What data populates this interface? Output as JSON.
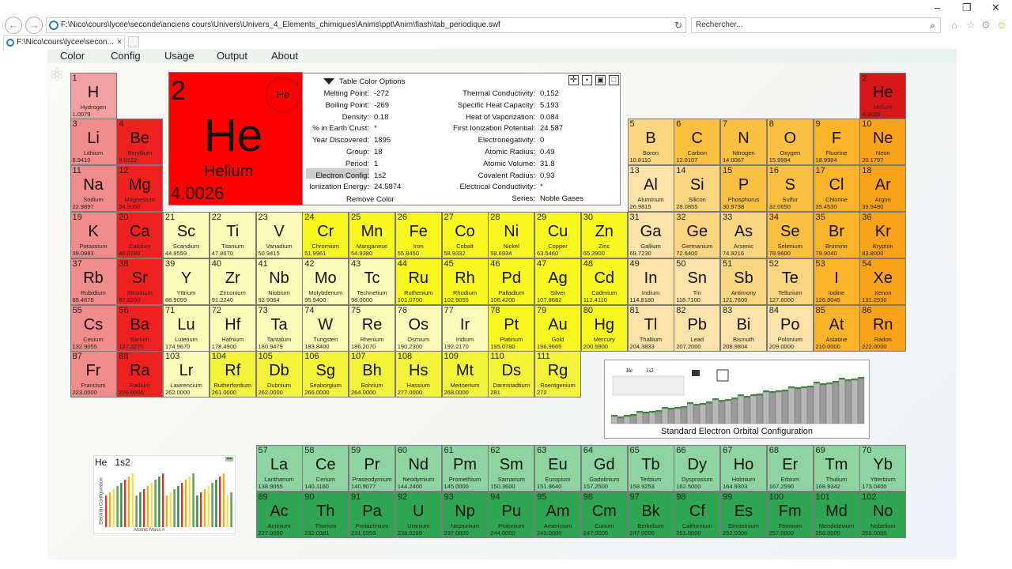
{
  "browser": {
    "address": "F:\\Nico\\cours\\lycee\\seconde\\anciens cours\\Univers\\Univers_4_Elements_chimiques\\Anims\\ppt\\Anim\\flash\\tab_periodique.swf",
    "search_placeholder": "Rechercher...",
    "tab_title": "F:\\Nico\\cours\\lycee\\secon...",
    "back_icon": "←",
    "forward_icon": "→",
    "refresh_icon": "↻",
    "tab_close": "×",
    "search_icon": "⌕",
    "minimize": "–",
    "restore": "❐",
    "close": "✕",
    "home_icon": "⌂",
    "star_icon": "☆",
    "gear_icon": "⚙",
    "smiley_icon": "☺"
  },
  "menu": [
    "Color",
    "Config",
    "Usage",
    "Output",
    "About"
  ],
  "selected": {
    "number": "2",
    "symbol": "He",
    "name": "Helium",
    "mass": "4.0026",
    "orbital_symbol": "He",
    "table_color_options": "Table Color Options",
    "remove_color": "Remove Color",
    "left_props": [
      [
        "Melting Point:",
        "-272"
      ],
      [
        "Boiling Point:",
        "-269"
      ],
      [
        "Density:",
        "0.18"
      ],
      [
        "% in Earth Crust:",
        "*"
      ],
      [
        "Year Discovered:",
        "1895"
      ],
      [
        "Group:",
        "18"
      ],
      [
        "Period:",
        "1"
      ],
      [
        "Electron Config:",
        "1s2"
      ],
      [
        "Ionization Energy:",
        "24.5874"
      ]
    ],
    "right_props": [
      [
        "Thermal Conductivity:",
        "0.152"
      ],
      [
        "Specific Heat Capacity:",
        "5.193"
      ],
      [
        "Heat of Vaporization:",
        "0.084"
      ],
      [
        "First Ionization Potential:",
        "24.587"
      ],
      [
        "Electronegativity:",
        "0"
      ],
      [
        "Atomic Radius:",
        "0.49"
      ],
      [
        "Atomic Volume:",
        "31.8"
      ],
      [
        "Covalent Radius:",
        "0.93"
      ],
      [
        "Electrical Conductivity:",
        "*"
      ],
      [
        "Series:",
        "Noble Gases"
      ]
    ]
  },
  "orbital_panel": {
    "caption": "Standard Electron Orbital Configuration",
    "title_symbol": "He",
    "title_config": "1s2"
  },
  "mini_chart": {
    "title_symbol": "He",
    "title_config": "1s2",
    "xlabel": "Atomic Mass #",
    "ylabel": "Electron Configuration"
  },
  "colors": {
    "alkali": "#f08c8c",
    "alkaline": "#ee2020",
    "transition": "#fdfbb8",
    "transition_bright": "#f8f820",
    "post": "#fbe2a8",
    "metalloid": "#fbd580",
    "nonmetal": "#fbc040",
    "halogen": "#fbb428",
    "noble": "#fba318",
    "helium": "#d81818",
    "hydrogen": "#f5a0a0",
    "superheavy": "#f3f33a",
    "lanthanide": "#8ed4a0",
    "actinide": "#2ea552"
  },
  "elements": [
    [
      "1",
      "H",
      "Hydrogen",
      "1.0079"
    ],
    [
      "2",
      "He",
      "Helium",
      "4.0026"
    ],
    [
      "3",
      "Li",
      "Lithium",
      "6.9410"
    ],
    [
      "4",
      "Be",
      "Beryllium",
      "9.0122"
    ],
    [
      "5",
      "B",
      "Boron",
      "10.8110"
    ],
    [
      "6",
      "C",
      "Carbon",
      "12.0107"
    ],
    [
      "7",
      "N",
      "Nitrogen",
      "14.0067"
    ],
    [
      "8",
      "O",
      "Oxygen",
      "15.9994"
    ],
    [
      "9",
      "F",
      "Fluorine",
      "18.9984"
    ],
    [
      "10",
      "Ne",
      "Neon",
      "20.1797"
    ],
    [
      "11",
      "Na",
      "Sodium",
      "22.9897"
    ],
    [
      "12",
      "Mg",
      "Magnesium",
      "24.3050"
    ],
    [
      "13",
      "Al",
      "Aluminum",
      "26.9815"
    ],
    [
      "14",
      "Si",
      "Silicon",
      "28.0855"
    ],
    [
      "15",
      "P",
      "Phosphorus",
      "30.9738"
    ],
    [
      "16",
      "S",
      "Sulfur",
      "32.0650"
    ],
    [
      "17",
      "Cl",
      "Chlorine",
      "35.4530"
    ],
    [
      "18",
      "Ar",
      "Argon",
      "39.9480"
    ],
    [
      "19",
      "K",
      "Potassium",
      "39.0983"
    ],
    [
      "20",
      "Ca",
      "Calcium",
      "40.0780"
    ],
    [
      "21",
      "Sc",
      "Scandium",
      "44.9559"
    ],
    [
      "22",
      "Ti",
      "Titanium",
      "47.8670"
    ],
    [
      "23",
      "V",
      "Vanadium",
      "50.9415"
    ],
    [
      "24",
      "Cr",
      "Chromium",
      "51.9961"
    ],
    [
      "25",
      "Mn",
      "Manganese",
      "54.9380"
    ],
    [
      "26",
      "Fe",
      "Iron",
      "55.8450"
    ],
    [
      "27",
      "Co",
      "Cobalt",
      "58.9332"
    ],
    [
      "28",
      "Ni",
      "Nickel",
      "58.6934"
    ],
    [
      "29",
      "Cu",
      "Copper",
      "63.5460"
    ],
    [
      "30",
      "Zn",
      "Zinc",
      "65.3900"
    ],
    [
      "31",
      "Ga",
      "Gallium",
      "69.7230"
    ],
    [
      "32",
      "Ge",
      "Germanium",
      "72.6400"
    ],
    [
      "33",
      "As",
      "Arsenic",
      "74.9216"
    ],
    [
      "34",
      "Se",
      "Selenium",
      "78.9600"
    ],
    [
      "35",
      "Br",
      "Bromine",
      "79.9040"
    ],
    [
      "36",
      "Kr",
      "Krypton",
      "83.8000"
    ],
    [
      "37",
      "Rb",
      "Rubidium",
      "85.4678"
    ],
    [
      "38",
      "Sr",
      "Strontium",
      "87.6200"
    ],
    [
      "39",
      "Y",
      "Yttrium",
      "88.9059"
    ],
    [
      "40",
      "Zr",
      "Zirconium",
      "91.2240"
    ],
    [
      "41",
      "Nb",
      "Niobium",
      "92.9064"
    ],
    [
      "42",
      "Mo",
      "Molybdenum",
      "95.9400"
    ],
    [
      "43",
      "Tc",
      "Technetium",
      "98.0000"
    ],
    [
      "44",
      "Ru",
      "Ruthenium",
      "101.0700"
    ],
    [
      "45",
      "Rh",
      "Rhodium",
      "102.9055"
    ],
    [
      "46",
      "Pd",
      "Palladium",
      "106.4200"
    ],
    [
      "47",
      "Ag",
      "Silver",
      "107.8682"
    ],
    [
      "48",
      "Cd",
      "Cadmium",
      "112.4110"
    ],
    [
      "49",
      "In",
      "Indium",
      "114.8180"
    ],
    [
      "50",
      "Sn",
      "Tin",
      "118.7100"
    ],
    [
      "51",
      "Sb",
      "Antimony",
      "121.7600"
    ],
    [
      "52",
      "Te",
      "Tellurium",
      "127.6000"
    ],
    [
      "53",
      "I",
      "Iodine",
      "126.9045"
    ],
    [
      "54",
      "Xe",
      "Xenon",
      "131.2930"
    ],
    [
      "55",
      "Cs",
      "Cesium",
      "132.9055"
    ],
    [
      "56",
      "Ba",
      "Barium",
      "137.3270"
    ],
    [
      "71",
      "Lu",
      "Lutetium",
      "174.9670"
    ],
    [
      "72",
      "Hf",
      "Hafnium",
      "178.4900"
    ],
    [
      "73",
      "Ta",
      "Tantalum",
      "180.9479"
    ],
    [
      "74",
      "W",
      "Tungsten",
      "183.8400"
    ],
    [
      "75",
      "Re",
      "Rhenium",
      "186.2070"
    ],
    [
      "76",
      "Os",
      "Osmium",
      "190.2300"
    ],
    [
      "77",
      "Ir",
      "Iridium",
      "192.2170"
    ],
    [
      "78",
      "Pt",
      "Platinum",
      "195.0780"
    ],
    [
      "79",
      "Au",
      "Gold",
      "196.9665"
    ],
    [
      "80",
      "Hg",
      "Mercury",
      "200.5900"
    ],
    [
      "81",
      "Tl",
      "Thallium",
      "204.3833"
    ],
    [
      "82",
      "Pb",
      "Lead",
      "207.2000"
    ],
    [
      "83",
      "Bi",
      "Bismuth",
      "208.9804"
    ],
    [
      "84",
      "Po",
      "Polonium",
      "209.0000"
    ],
    [
      "85",
      "At",
      "Astatine",
      "210.0000"
    ],
    [
      "86",
      "Rn",
      "Radon",
      "222.0000"
    ],
    [
      "87",
      "Fr",
      "Francium",
      "223.0000"
    ],
    [
      "88",
      "Ra",
      "Radium",
      "226.0000"
    ],
    [
      "103",
      "Lr",
      "Lawrencium",
      "262.0000"
    ],
    [
      "104",
      "Rf",
      "Rutherfordium",
      "261.0000"
    ],
    [
      "105",
      "Db",
      "Dubnium",
      "262.0000"
    ],
    [
      "106",
      "Sg",
      "Seaborgium",
      "266.0000"
    ],
    [
      "107",
      "Bh",
      "Bohrium",
      "264.0000"
    ],
    [
      "108",
      "Hs",
      "Hassium",
      "277.0000"
    ],
    [
      "109",
      "Mt",
      "Meitnerium",
      "268.0000"
    ],
    [
      "110",
      "Ds",
      "Darmstadtium",
      "281"
    ],
    [
      "111",
      "Rg",
      "Roentgenium",
      "272"
    ],
    [
      "57",
      "La",
      "Lanthanum",
      "138.9055"
    ],
    [
      "58",
      "Ce",
      "Cerium",
      "140.1160"
    ],
    [
      "59",
      "Pr",
      "Praseodymium",
      "140.9077"
    ],
    [
      "60",
      "Nd",
      "Neodymium",
      "144.2400"
    ],
    [
      "61",
      "Pm",
      "Promethium",
      "145.0000"
    ],
    [
      "62",
      "Sm",
      "Samarium",
      "150.3600"
    ],
    [
      "63",
      "Eu",
      "Europium",
      "151.9640"
    ],
    [
      "64",
      "Gd",
      "Gadolinium",
      "157.2500"
    ],
    [
      "65",
      "Tb",
      "Terbium",
      "158.9253"
    ],
    [
      "66",
      "Dy",
      "Dysprosium",
      "162.5000"
    ],
    [
      "67",
      "Ho",
      "Holmium",
      "164.9303"
    ],
    [
      "68",
      "Er",
      "Erbium",
      "167.2590"
    ],
    [
      "69",
      "Tm",
      "Thulium",
      "168.9342"
    ],
    [
      "70",
      "Yb",
      "Ytterbium",
      "173.0400"
    ],
    [
      "89",
      "Ac",
      "Actinium",
      "227.0000"
    ],
    [
      "90",
      "Th",
      "Thorium",
      "232.0381"
    ],
    [
      "91",
      "Pa",
      "Protactinium",
      "231.0359"
    ],
    [
      "92",
      "U",
      "Uranium",
      "238.0289"
    ],
    [
      "93",
      "Np",
      "Neptunium",
      "237.0000"
    ],
    [
      "94",
      "Pu",
      "Plutonium",
      "244.0000"
    ],
    [
      "95",
      "Am",
      "Americium",
      "243.0000"
    ],
    [
      "96",
      "Cm",
      "Curium",
      "247.0000"
    ],
    [
      "97",
      "Bk",
      "Berkelium",
      "247.0000"
    ],
    [
      "98",
      "Cf",
      "Californium",
      "251.0000"
    ],
    [
      "99",
      "Es",
      "Einsteinium",
      "252.0000"
    ],
    [
      "100",
      "Fm",
      "Fermium",
      "257.0000"
    ],
    [
      "101",
      "Md",
      "Mendelevium",
      "258.0000"
    ],
    [
      "102",
      "No",
      "Nobelium",
      "259.0000"
    ]
  ]
}
